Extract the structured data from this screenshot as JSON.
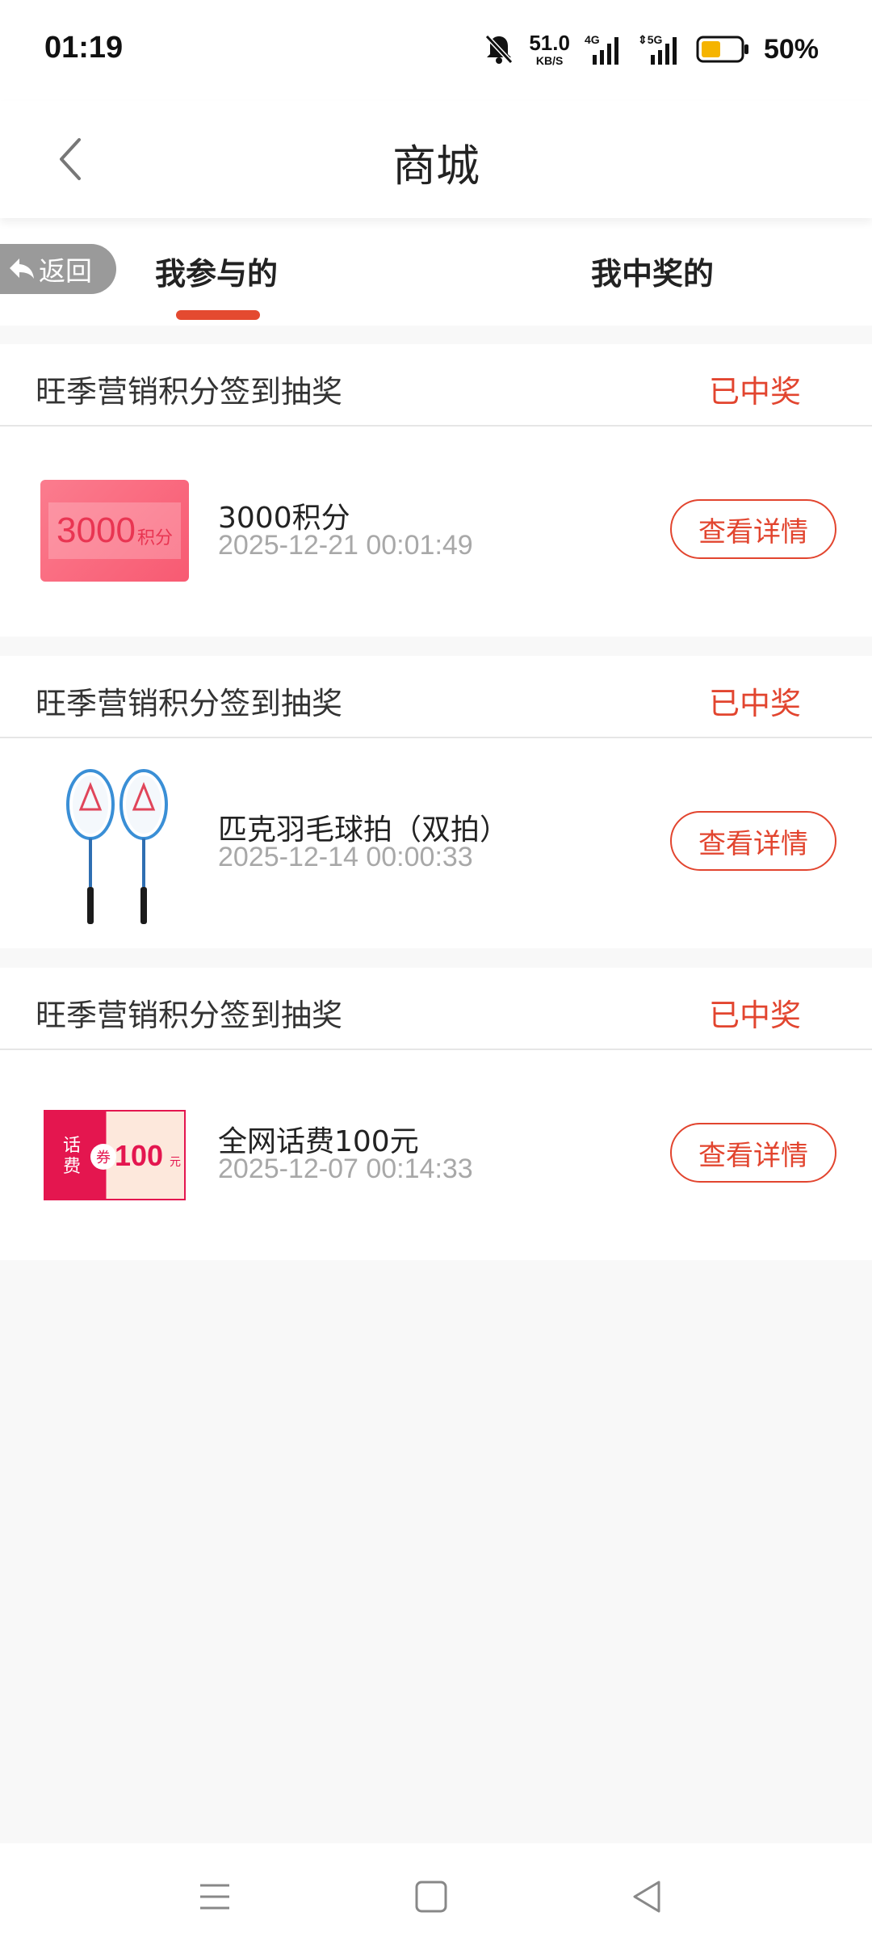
{
  "status_bar": {
    "time": "01:19",
    "net_speed_value": "51.0",
    "net_speed_unit": "KB/S",
    "signal_1": "4G",
    "signal_2": "5G",
    "battery_percent": "50%",
    "battery_level": 0.5
  },
  "header": {
    "title": "商城"
  },
  "tabs": {
    "return_label": "返回",
    "items": [
      {
        "label": "我参与的",
        "active": true
      },
      {
        "label": "我中奖的",
        "active": false
      }
    ]
  },
  "records": [
    {
      "activity": "旺季营销积分签到抽奖",
      "status": "已中奖",
      "prize_name": "3000积分",
      "time": "2025-12-21 00:01:49",
      "thumb_number": "3000",
      "thumb_unit": "积分",
      "button": "查看详情"
    },
    {
      "activity": "旺季营销积分签到抽奖",
      "status": "已中奖",
      "prize_name": "匹克羽毛球拍（双拍）",
      "time": "2025-12-14 00:00:33",
      "button": "查看详情"
    },
    {
      "activity": "旺季营销积分签到抽奖",
      "status": "已中奖",
      "prize_name": "全网话费100元",
      "time": "2025-12-07 00:14:33",
      "thumb_label": "话费",
      "thumb_badge": "券",
      "thumb_amount": "100",
      "thumb_unit": "元",
      "button": "查看详情"
    }
  ],
  "colors": {
    "accent": "#e2452f",
    "indicator": "#e44a30",
    "muted_text": "#a8a8a8",
    "background": "#f8f8f8"
  }
}
